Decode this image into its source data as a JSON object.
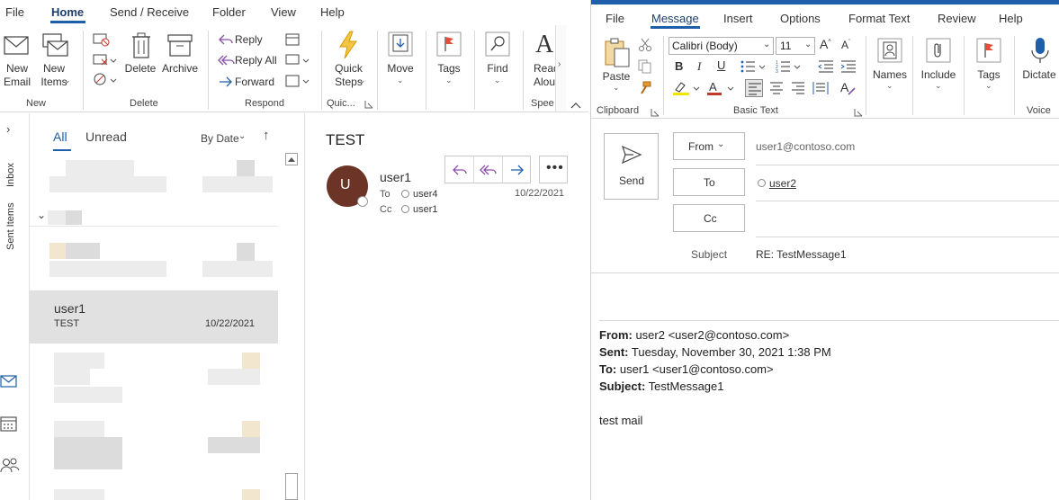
{
  "left_window": {
    "tabs": [
      "File",
      "Home",
      "Send / Receive",
      "Folder",
      "View",
      "Help"
    ],
    "active_tab": "Home",
    "ribbon": {
      "new_email": "New\nEmail",
      "new_items": "New\nItems",
      "delete": "Delete",
      "archive": "Archive",
      "reply": "Reply",
      "reply_all": "Reply All",
      "forward": "Forward",
      "quick_steps": "Quick\nSteps",
      "move": "Move",
      "tags": "Tags",
      "find": "Find",
      "read_aloud": "Read\nAloud",
      "groups": {
        "new": "New",
        "delete": "Delete",
        "respond": "Respond",
        "quick": "Quic...",
        "speech": "Spee"
      }
    },
    "rail": {
      "inbox": "Inbox",
      "sent_items": "Sent Items"
    },
    "message_list": {
      "filter_all": "All",
      "filter_unread": "Unread",
      "sort": "By Date",
      "selected_item": {
        "sender": "user1",
        "subject": "TEST",
        "date": "10/22/2021"
      }
    },
    "reading_pane": {
      "subject": "TEST",
      "avatar_letter": "U",
      "sender": "user1",
      "to_label": "To",
      "to_value": "user4",
      "cc_label": "Cc",
      "cc_value": "user1",
      "date": "10/22/2021"
    }
  },
  "right_window": {
    "tabs": [
      "File",
      "Message",
      "Insert",
      "Options",
      "Format Text",
      "Review",
      "Help"
    ],
    "active_tab": "Message",
    "ribbon": {
      "paste": "Paste",
      "font_name": "Calibri (Body)",
      "font_size": "11",
      "names": "Names",
      "include": "Include",
      "tags": "Tags",
      "dictate": "Dictate",
      "groups": {
        "clipboard": "Clipboard",
        "basic_text": "Basic Text",
        "voice": "Voice"
      }
    },
    "compose": {
      "send": "Send",
      "from_label": "From",
      "from_value": "user1@contoso.com",
      "to_label": "To",
      "to_value": "user2",
      "cc_label": "Cc",
      "subject_label": "Subject",
      "subject_value": "RE: TestMessage1"
    },
    "quoted": {
      "from_label": "From:",
      "from_value": " user2 <user2@contoso.com>",
      "sent_label": "Sent:",
      "sent_value": " Tuesday, November 30, 2021 1:38 PM",
      "to_label": "To:",
      "to_value": " user1 <user1@contoso.com>",
      "subject_label": "Subject:",
      "subject_value": " TestMessage1",
      "body": "test mail"
    }
  },
  "colors": {
    "accent": "#1f5ea8",
    "avatar_bg": "#6b3426",
    "selected_row": "#e1e1e1",
    "tab_underline": "#1f5ea8"
  }
}
